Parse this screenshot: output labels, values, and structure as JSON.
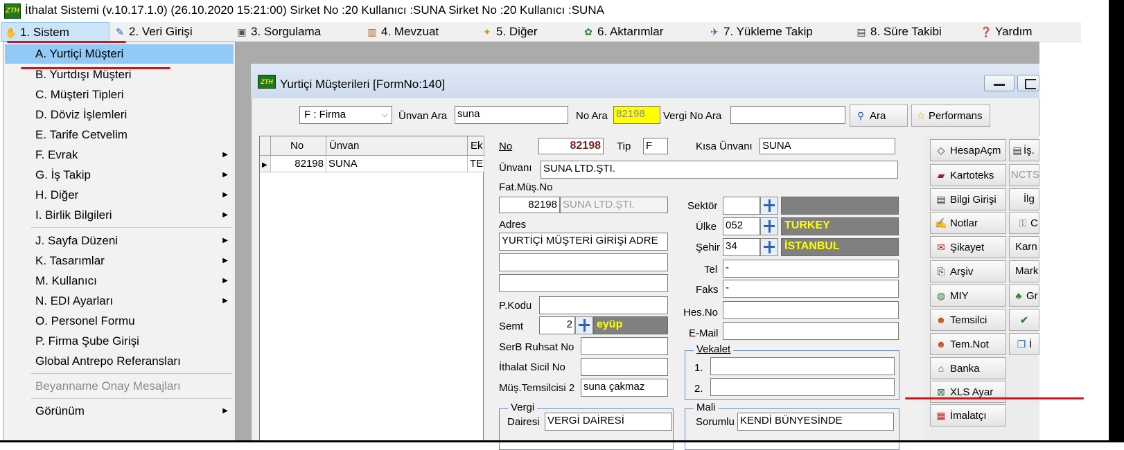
{
  "window": {
    "title": "İthalat Sistemi (v.10.17.1.0) (26.10.2020 15:21:00) Sirket No :20 Kullanıcı :SUNA Sirket No :20 Kullanıcı :SUNA",
    "icon_text": "ZTH"
  },
  "menu": [
    {
      "label": "1.  Sistem",
      "icon": "hand-icon"
    },
    {
      "label": "2.  Veri Girişi",
      "icon": "edit-icon"
    },
    {
      "label": "3.  Sorgulama",
      "icon": "query-icon"
    },
    {
      "label": "4.  Mevzuat",
      "icon": "books-icon"
    },
    {
      "label": "5.  Diğer",
      "icon": "misc-icon"
    },
    {
      "label": "6.  Aktarımlar",
      "icon": "transfer-icon"
    },
    {
      "label": "7.  Yükleme Takip",
      "icon": "plane-icon"
    },
    {
      "label": "8. Süre Takibi",
      "icon": "clipboard-icon"
    },
    {
      "label": "Yardım",
      "icon": "help-icon"
    }
  ],
  "dropdown": [
    {
      "label": "A.  Yurtiçi Müşteri",
      "arrow": ""
    },
    {
      "label": "B.  Yurtdışı Müşteri",
      "arrow": ""
    },
    {
      "label": "C.  Müşteri Tipleri",
      "arrow": ""
    },
    {
      "label": "D.  Döviz İşlemleri",
      "arrow": ""
    },
    {
      "label": "E.  Tarife Cetvelim",
      "arrow": ""
    },
    {
      "label": "F.  Evrak",
      "arrow": "▶"
    },
    {
      "label": "G.  İş Takip",
      "arrow": "▶"
    },
    {
      "label": "H.  Diğer",
      "arrow": "▶"
    },
    {
      "label": "I.  Birlik Bilgileri",
      "arrow": "▶"
    },
    {
      "label": "J.  Sayfa Düzeni",
      "arrow": "▶"
    },
    {
      "label": "K.  Tasarımlar",
      "arrow": "▶"
    },
    {
      "label": "M.   Kullanıcı",
      "arrow": "▶"
    },
    {
      "label": "N.  EDI Ayarları",
      "arrow": "▶"
    },
    {
      "label": "O.  Personel Formu",
      "arrow": ""
    },
    {
      "label": "P.   Firma Şube Girişi",
      "arrow": ""
    },
    {
      "label": "Global Antrepo Referansları",
      "arrow": ""
    },
    {
      "label": "Beyanname Onay Mesajları",
      "arrow": ""
    },
    {
      "label": "Görünüm",
      "arrow": "▶"
    }
  ],
  "form": {
    "title": "Yurtiçi Müşterileri [FormNo:140]",
    "icon_text": "ZTH",
    "search": {
      "type_value": "F : Firma",
      "unvan_label": "Ünvan Ara",
      "unvan_value": "suna",
      "no_label": "No Ara",
      "no_value": "82198",
      "vergi_label": "Vergi No Ara",
      "vergi_value": "",
      "ara_button": "Ara",
      "performans_button": "Performans"
    },
    "grid": {
      "headers": [
        "No",
        "Ünvan",
        "Ek"
      ],
      "rows": [
        {
          "no": "82198",
          "unvan": "SUNA",
          "ek": "TE"
        }
      ]
    },
    "fields": {
      "no_label": "No",
      "no_value": "82198",
      "tip_label": "Tip",
      "tip_value": "F",
      "kisa_label": "Kısa Ünvanı",
      "kisa_value": "SUNA",
      "unvani_label": "Ünvanı",
      "unvani_value": "SUNA LTD.ŞTI.",
      "fatmus_label": "Fat.Müş.No",
      "fatmus_no": "82198",
      "fatmus_name": "SUNA LTD.ŞTI.",
      "adres_label": "Adres",
      "adres1": "YURTİÇİ MÜŞTERİ GİRİŞİ ADRE",
      "adres2": "",
      "adres3": "",
      "pkodu_label": "P.Kodu",
      "pkodu_value": "",
      "semt_label": "Semt",
      "semt_value": "2",
      "semt_name": "eyüp",
      "serb_label": "SerB Ruhsat No",
      "serb_value": "",
      "ithalat_label": "İthalat Sicil No",
      "ithalat_value": "",
      "temsilci_label": "Müş.Temsilcisi 2",
      "temsilci_value": "suna çakmaz",
      "sektor_label": "Sektör",
      "sektor_value": "",
      "sektor_name": "",
      "ulke_label": "Ülke",
      "ulke_value": "052",
      "ulke_name": "TURKEY",
      "sehir_label": "Şehir",
      "sehir_value": "34",
      "sehir_name": "İSTANBUL",
      "tel_label": "Tel",
      "tel_value": "-",
      "faks_label": "Faks",
      "faks_value": "-",
      "hesno_label": "Hes.No",
      "hesno_value": "",
      "email_label": "E-Mail",
      "email_value": "",
      "vekalet_label": "Vekalet",
      "vekalet1_label": "1.",
      "vekalet1_value": "",
      "vekalet2_label": "2.",
      "vekalet2_value": "",
      "vergi_group": "Vergi",
      "vergi_dairesi_label": "Dairesi",
      "vergi_dairesi_value": "VERGİ DAİRESİ",
      "mali_group": "Mali",
      "sorumlu_label": "Sorumlu",
      "sorumlu_value": "KENDİ BÜNYESİNDE"
    },
    "side_buttons": [
      {
        "label": "HesapAçm",
        "icon": "tag-icon"
      },
      {
        "label": "Kartoteks",
        "icon": "cards-icon"
      },
      {
        "label": "Bilgi Girişi",
        "icon": "document-icon"
      },
      {
        "label": "Notlar",
        "icon": "notes-icon"
      },
      {
        "label": "Şikayet",
        "icon": "complaint-icon"
      },
      {
        "label": "Arşiv",
        "icon": "archive-icon"
      },
      {
        "label": "MIY",
        "icon": "globe-icon"
      },
      {
        "label": "Temsilci",
        "icon": "people-icon"
      },
      {
        "label": "Tem.Not",
        "icon": "people-note-icon"
      },
      {
        "label": "Banka",
        "icon": "bank-icon"
      },
      {
        "label": "XLS Ayar",
        "icon": "excel-icon"
      },
      {
        "label": "İmalatçı",
        "icon": "factory-icon"
      }
    ],
    "side_buttons2": [
      {
        "label": "İş.",
        "icon": "clipboard-icon"
      },
      {
        "label": "NCTS",
        "icon": ""
      },
      {
        "label": "İlg",
        "icon": ""
      },
      {
        "label": "C",
        "icon": "key-icon"
      },
      {
        "label": "Karn",
        "icon": ""
      },
      {
        "label": "Mark",
        "icon": ""
      },
      {
        "label": "Gr",
        "icon": "group-icon"
      },
      {
        "label": "",
        "icon": "check-icon"
      },
      {
        "label": "İ",
        "icon": "copy-icon"
      }
    ]
  }
}
